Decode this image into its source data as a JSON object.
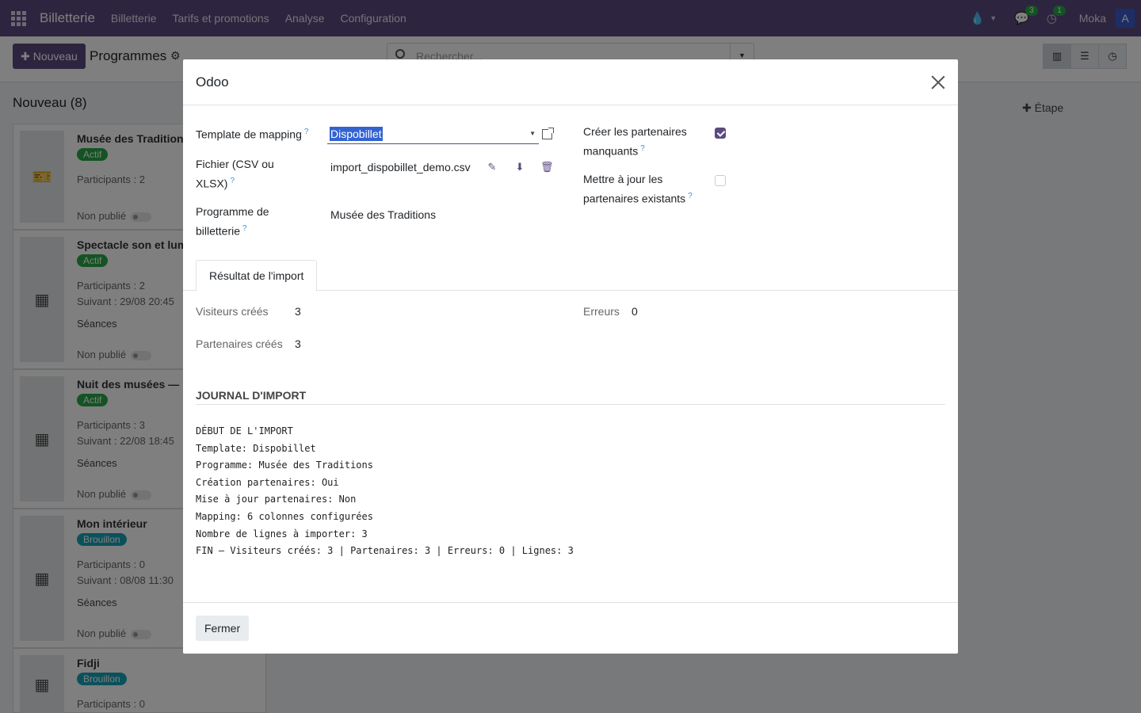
{
  "navbar": {
    "brand": "Billetterie",
    "menu": [
      "Billetterie",
      "Tarifs et promotions",
      "Analyse",
      "Configuration"
    ],
    "messages_count": "3",
    "activities_count": "1",
    "user_name": "Moka",
    "avatar_letter": "A"
  },
  "control": {
    "new_label": "Nouveau",
    "breadcrumb": "Programmes",
    "search_placeholder": "Rechercher..."
  },
  "kanban": {
    "column_title": "Nouveau (8)",
    "add_stage": "Étape",
    "cards": [
      {
        "title": "Musée des Traditions",
        "status": "Actif",
        "participants": "Participants : 2",
        "published": "Non publié"
      },
      {
        "title": "Spectacle son et lumière",
        "status": "Actif",
        "participants": "Participants : 2",
        "next": "Suivant : 29/08 20:45",
        "sessions": "Séances",
        "published": "Non publié"
      },
      {
        "title": "Nuit des musées — ",
        "status": "Actif",
        "participants": "Participants : 3",
        "next": "Suivant : 22/08 18:45",
        "sessions": "Séances",
        "published": "Non publié"
      },
      {
        "title": "Mon intérieur",
        "status": "Brouillon",
        "participants": "Participants : 0",
        "next": "Suivant : 08/08 11:30",
        "sessions": "Séances",
        "published": "Non publié"
      },
      {
        "title": "Fidji",
        "status": "Brouillon",
        "participants": "Participants : 0"
      }
    ]
  },
  "colors": {
    "brand": "#5b4b7f",
    "active": "#28a745",
    "draft": "#17a2b8"
  },
  "modal": {
    "title": "Odoo",
    "fields": {
      "template_label": "Template de mapping",
      "template_value": "Dispobillet",
      "file_label_1": "Fichier (CSV ou",
      "file_label_2": "XLSX)",
      "file_value": "import_dispobillet_demo.csv",
      "program_label_1": "Programme de",
      "program_label_2": "billetterie",
      "program_value": "Musée des Traditions",
      "create_partners_1": "Créer les partenaires",
      "create_partners_2": "manquants",
      "update_partners_1": "Mettre à jour les",
      "update_partners_2": "partenaires existants",
      "help": "?"
    },
    "create_partners_checked": true,
    "update_partners_checked": false,
    "tab_label": "Résultat de l'import",
    "results": {
      "visitors_label": "Visiteurs créés",
      "visitors_value": "3",
      "partners_label": "Partenaires créés",
      "partners_value": "3",
      "errors_label": "Erreurs",
      "errors_value": "0"
    },
    "log_title": "JOURNAL D'IMPORT",
    "log_lines": [
      "DÉBUT DE L'IMPORT",
      "Template: Dispobillet",
      "Programme: Musée des Traditions",
      "Création partenaires: Oui",
      "Mise à jour partenaires: Non",
      "Mapping: 6 colonnes configurées",
      "Nombre de lignes à importer: 3",
      "FIN — Visiteurs créés: 3 | Partenaires: 3 | Erreurs: 0 | Lignes: 3"
    ],
    "close_button": "Fermer"
  }
}
